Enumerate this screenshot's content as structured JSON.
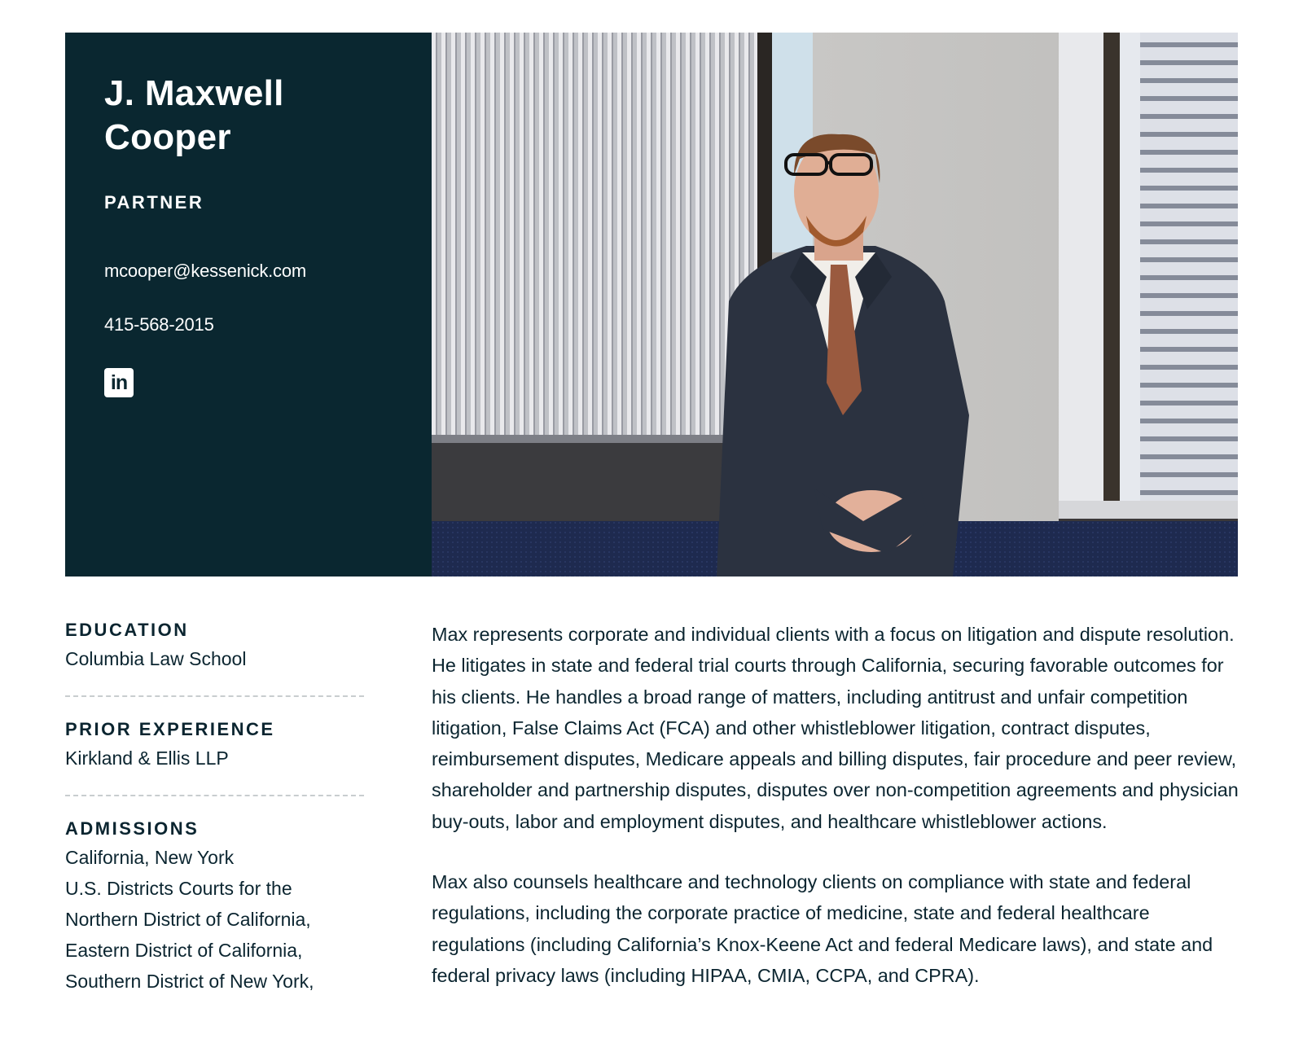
{
  "profile": {
    "name_line1": "J. Maxwell",
    "name_line2": "Cooper",
    "title": "PARTNER",
    "email": "mcooper@kessenick.com",
    "phone": "415-568-2015",
    "linkedin_icon": "linkedin-icon",
    "linkedin_glyph": "in"
  },
  "sidebar": {
    "education_heading": "EDUCATION",
    "education_value": "Columbia Law School",
    "experience_heading": "PRIOR EXPERIENCE",
    "experience_value": "Kirkland & Ellis LLP",
    "admissions_heading": "ADMISSIONS",
    "admissions_lines": [
      "California, New York",
      "U.S. Districts Courts for the",
      "Northern District of California,",
      "Eastern District of California,",
      "Southern District of New York,"
    ]
  },
  "bio": {
    "paragraph1": "Max represents corporate and individual clients with a focus on litigation and dispute resolution. He litigates in state and federal trial courts through California, securing favorable outcomes for his clients. He handles a broad range of matters, including antitrust and unfair competition litigation, False Claims Act (FCA) and other whistleblower litigation, contract disputes, reimbursement disputes, Medicare appeals and billing disputes, fair procedure and peer review, shareholder and partnership disputes, disputes over non-competition agreements and physician buy-outs, labor and employment disputes, and healthcare whistleblower actions.",
    "paragraph2": "Max also counsels healthcare and technology clients on compliance with state and federal regulations, including the corporate practice of medicine, state and federal healthcare regulations (including California’s Knox-Keene Act and federal Medicare laws), and state and federal privacy laws (including HIPAA, CMIA, CCPA, and CPRA)."
  },
  "colors": {
    "panel": "#0a2730",
    "text": "#0b2530",
    "divider": "#c8cdcf"
  }
}
